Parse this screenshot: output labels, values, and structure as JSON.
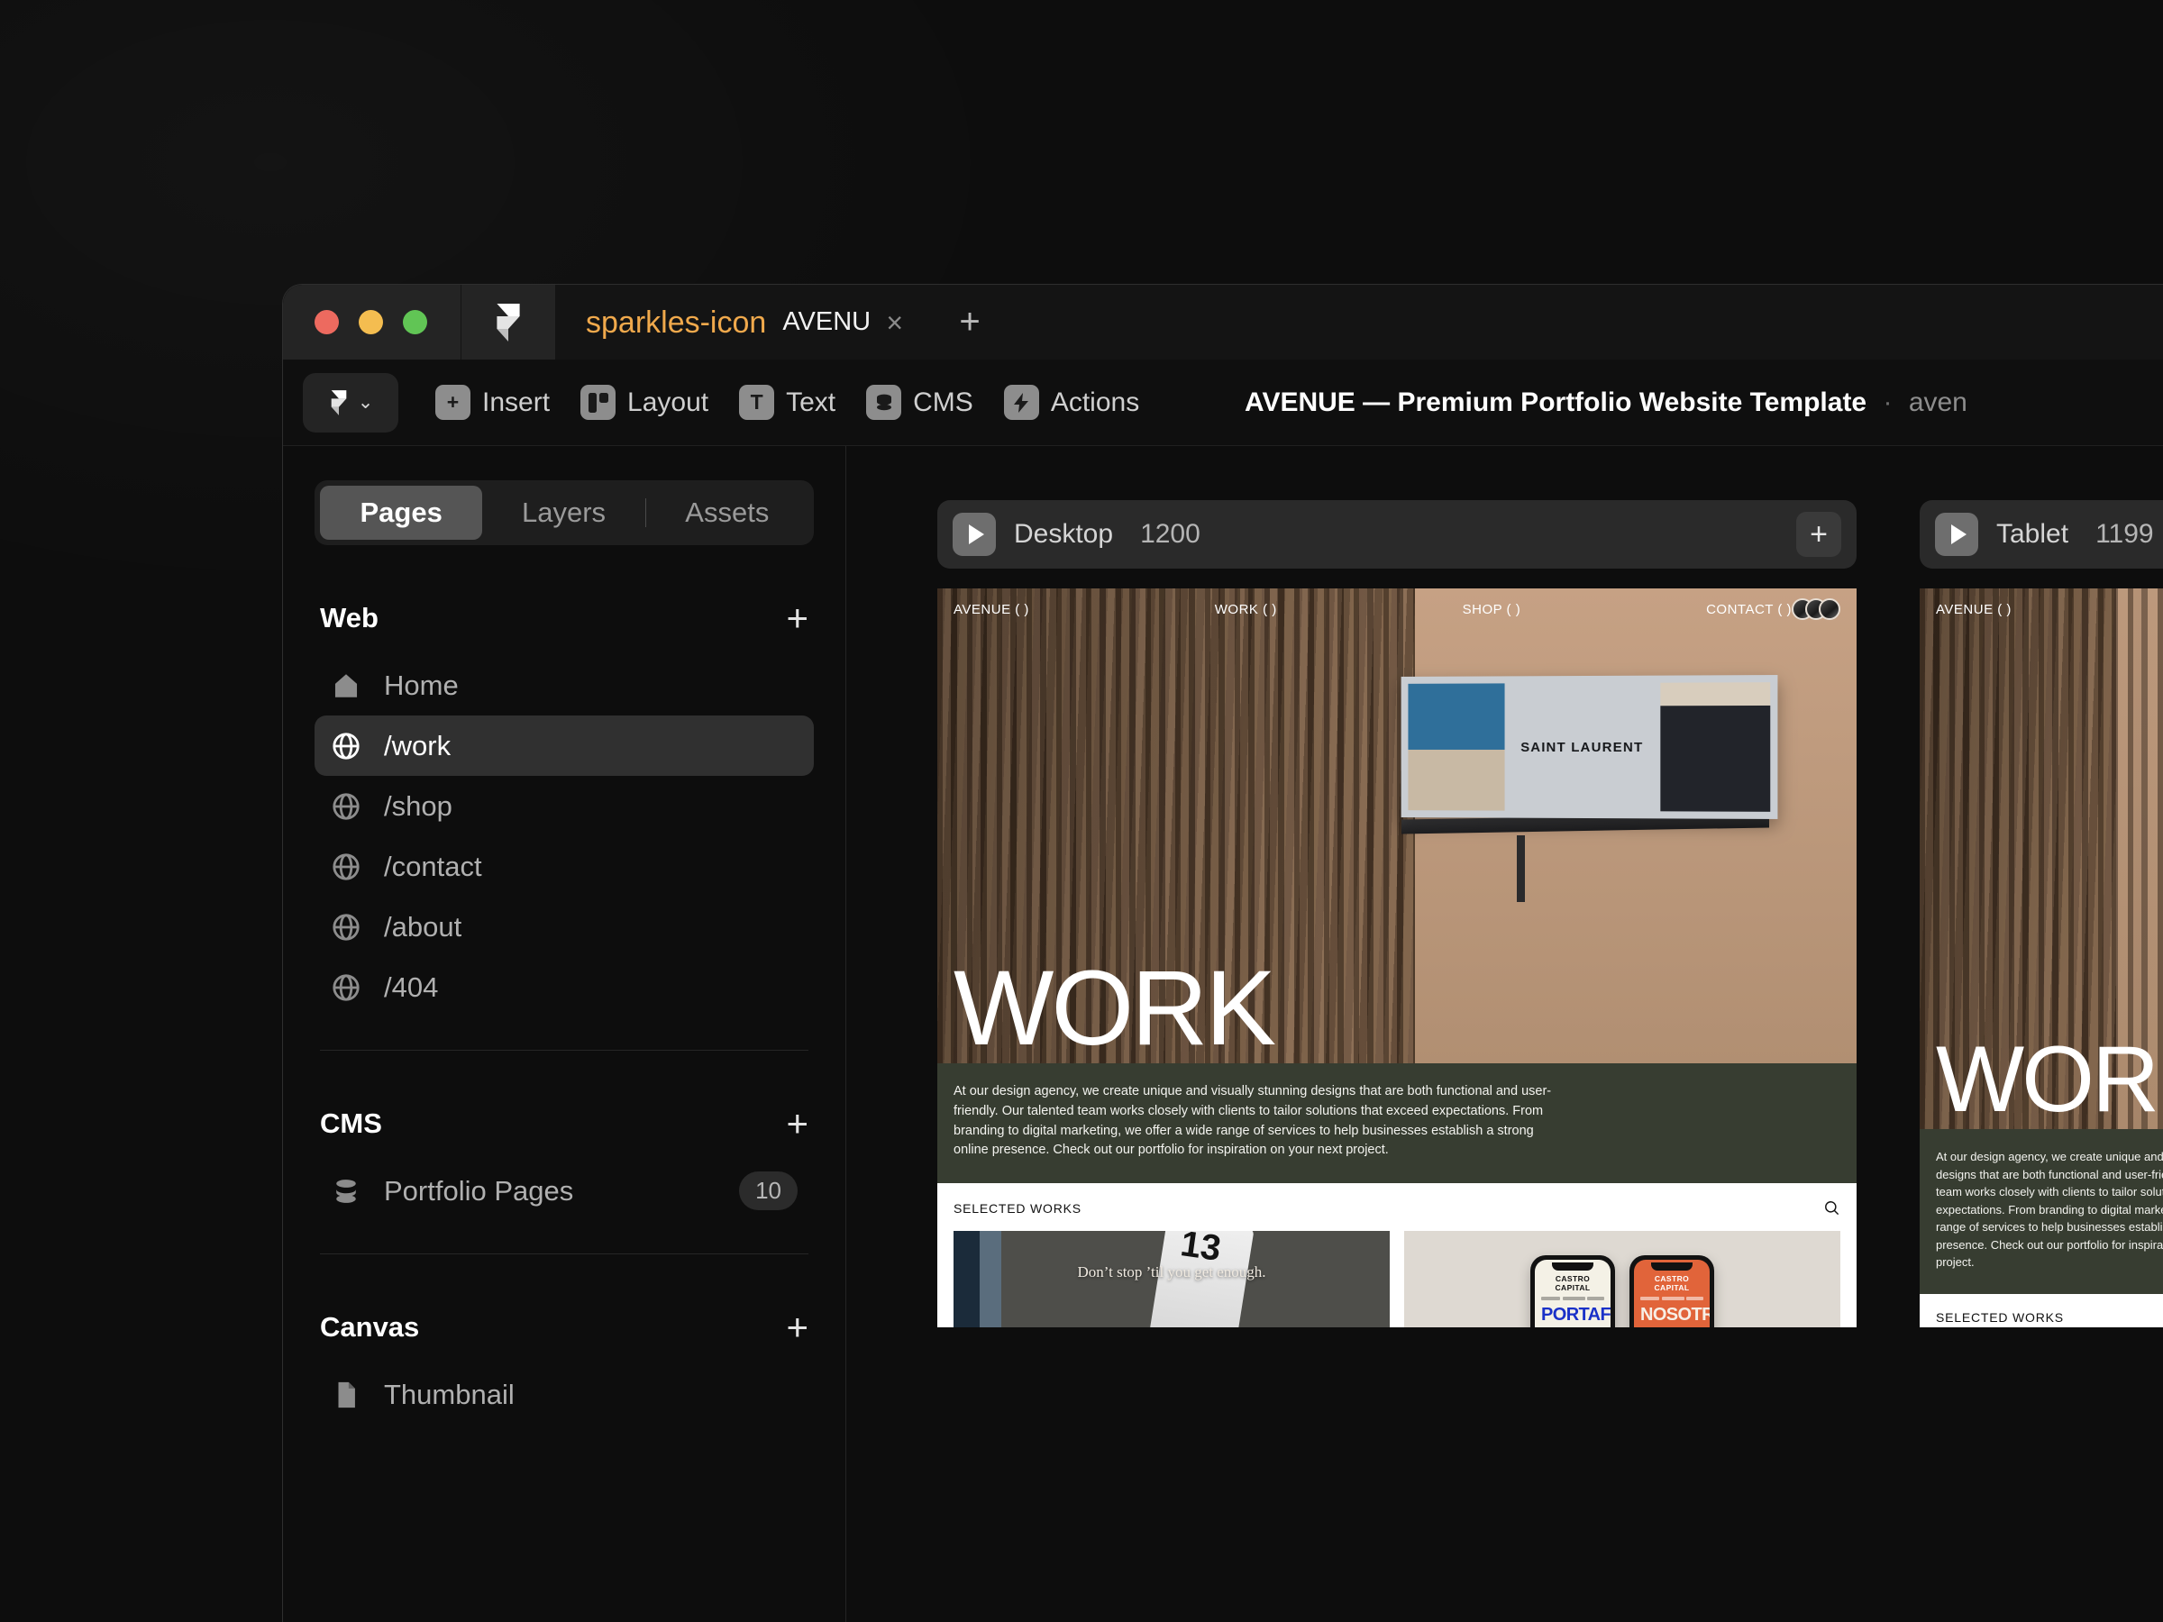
{
  "window": {
    "traffic_lights": [
      "close",
      "minimize",
      "zoom"
    ]
  },
  "tabbar": {
    "app_icon": "framer-logo-icon",
    "tab": {
      "favicon": "sparkles-icon",
      "title": "AVENUE — Premiu.",
      "close_label": "×"
    },
    "new_tab_label": "+"
  },
  "toolbar": {
    "menu_icon": "framer-logo-icon",
    "menu_chevron": "⌄",
    "items": [
      {
        "label": "Insert",
        "icon": "plus-square-icon",
        "glyph": "+"
      },
      {
        "label": "Layout",
        "icon": "layout-columns-icon",
        "glyph": ""
      },
      {
        "label": "Text",
        "icon": "text-t-icon",
        "glyph": "T"
      },
      {
        "label": "CMS",
        "icon": "database-icon",
        "glyph": ""
      },
      {
        "label": "Actions",
        "icon": "lightning-bolt-icon",
        "glyph": "⚡"
      }
    ],
    "document_name": "AVENUE — Premium Portfolio Website Template",
    "document_separator": "·",
    "document_sub": "aven"
  },
  "sidebar": {
    "tabs": [
      {
        "label": "Pages",
        "active": true
      },
      {
        "label": "Layers",
        "active": false
      },
      {
        "label": "Assets",
        "active": false
      }
    ],
    "sections": [
      {
        "title": "Web",
        "add_label": "+",
        "items": [
          {
            "label": "Home",
            "icon": "home-icon",
            "active": false,
            "badge": ""
          },
          {
            "label": "/work",
            "icon": "globe-icon",
            "active": true,
            "badge": ""
          },
          {
            "label": "/shop",
            "icon": "globe-icon",
            "active": false,
            "badge": ""
          },
          {
            "label": "/contact",
            "icon": "globe-icon",
            "active": false,
            "badge": ""
          },
          {
            "label": "/about",
            "icon": "globe-icon",
            "active": false,
            "badge": ""
          },
          {
            "label": "/404",
            "icon": "globe-icon",
            "active": false,
            "badge": ""
          }
        ]
      },
      {
        "title": "CMS",
        "add_label": "+",
        "items": [
          {
            "label": "Portfolio Pages",
            "icon": "database-icon",
            "active": false,
            "badge": "10"
          }
        ]
      },
      {
        "title": "Canvas",
        "add_label": "+",
        "items": [
          {
            "label": "Thumbnail",
            "icon": "file-icon",
            "active": false,
            "badge": ""
          }
        ]
      }
    ]
  },
  "canvas": {
    "breakpoints": [
      {
        "name": "Desktop",
        "width": "1200",
        "play_icon": "play-icon",
        "add_label": "+"
      },
      {
        "name": "Tablet",
        "width": "1199",
        "play_icon": "play-icon",
        "add_label": "+"
      }
    ]
  },
  "site": {
    "nav": [
      {
        "label": "AVENUE ( )"
      },
      {
        "label": "WORK ( )"
      },
      {
        "label": "SHOP ( )"
      },
      {
        "label": "CONTACT ( )"
      }
    ],
    "billboard_brand": "SAINT LAURENT",
    "hero_heading": "WORK",
    "intro_paragraph": "At our design agency, we create unique and visually stunning designs that are both functional and user-friendly. Our talented team works closely with clients to tailor solutions that exceed expectations. From branding to digital marketing, we offer a wide range of services to help businesses establish a strong online presence. Check out our portfolio for inspiration on your next project.",
    "works_label": "SELECTED WORKS",
    "search_icon": "magnifier-icon",
    "cards": [
      {
        "caption": "Don’t stop ’til you get enough.",
        "jersey_number": "13"
      },
      {
        "phones": [
          {
            "brand": "CASTRO CAPITAL",
            "headline": "PORTAFOLIO",
            "theme": "cream"
          },
          {
            "brand": "CASTRO CAPITAL",
            "headline": "NOSOTROS",
            "theme": "orange"
          }
        ]
      }
    ]
  },
  "colors": {
    "window_bg": "#151515",
    "sidebar_bg": "#0d0d0d",
    "active_item": "#303030",
    "accent_spark": "#f0a94c",
    "intro_green": "#373d31",
    "orange_phone": "#e1643a",
    "blue_headline": "#1a31c8"
  }
}
